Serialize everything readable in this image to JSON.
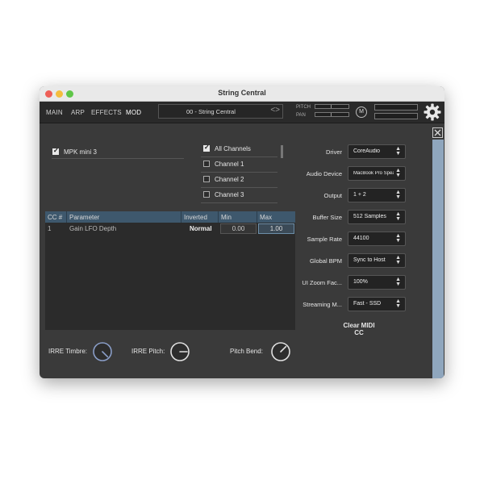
{
  "window": {
    "title": "String Central"
  },
  "nav": {
    "tabs": [
      "MAIN",
      "ARP",
      "EFFECTS",
      "MOD"
    ],
    "preset": "00 - String Central",
    "pitch_label": "PITCH",
    "pan_label": "PAN",
    "m_button": "M"
  },
  "midi": {
    "device": {
      "label": "MPK mini 3",
      "checked": true
    },
    "channels": [
      {
        "label": "All Channels",
        "checked": true
      },
      {
        "label": "Channel 1",
        "checked": false
      },
      {
        "label": "Channel 2",
        "checked": false
      },
      {
        "label": "Channel 3",
        "checked": false
      }
    ]
  },
  "cc_table": {
    "headers": [
      "CC #",
      "Parameter",
      "Inverted",
      "Min",
      "Max"
    ],
    "rows": [
      {
        "cc": "1",
        "parameter": "Gain LFO Depth",
        "inverted": "Normal",
        "min": "0.00",
        "max": "1.00"
      }
    ]
  },
  "settings": [
    {
      "label": "Driver",
      "value": "CoreAudio"
    },
    {
      "label": "Audio Device",
      "value": "MacBook Pro Spea..."
    },
    {
      "label": "Output",
      "value": "1 + 2"
    },
    {
      "label": "Buffer Size",
      "value": "512 Samples"
    },
    {
      "label": "Sample Rate",
      "value": "44100"
    },
    {
      "label": "Global BPM",
      "value": "Sync to Host"
    },
    {
      "label": "UI Zoom Fac...",
      "value": "100%"
    },
    {
      "label": "Streaming M...",
      "value": "Fast - SSD"
    }
  ],
  "clear_midi_cc": "Clear MIDI CC",
  "knobs": [
    {
      "label": "IRRE Timbre:",
      "angle": 135,
      "color": "#8a9ec8"
    },
    {
      "label": "IRRE Pitch:",
      "angle": 90,
      "color": "#e0e0e0"
    },
    {
      "label": "Pitch Bend:",
      "angle": 45,
      "color": "#e0e0e0"
    }
  ],
  "colors": {
    "panel": "#3a3a3a",
    "table_header": "#3e586d",
    "scrollbar": "#8fa6bd",
    "selected_cell": "#6d8ea8"
  }
}
